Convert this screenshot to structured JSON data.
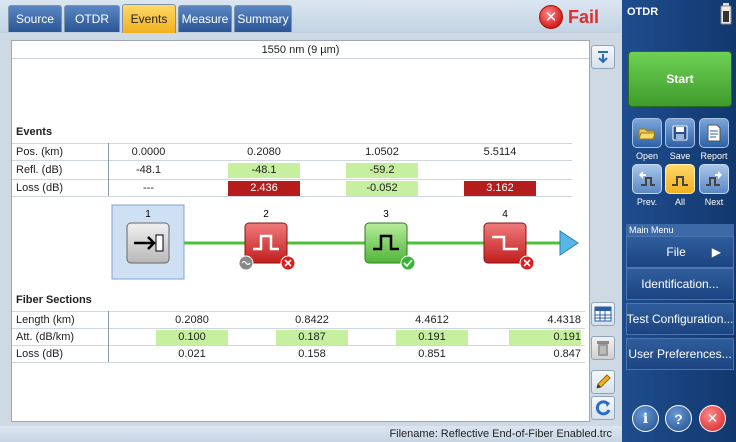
{
  "tabs": [
    {
      "label": "Source"
    },
    {
      "label": "OTDR"
    },
    {
      "label": "Events"
    },
    {
      "label": "Measure"
    },
    {
      "label": "Summary"
    }
  ],
  "active_tab": "Events",
  "status": {
    "text": "Fail",
    "color": "#e12d2d"
  },
  "wavelength": "1550 nm (9 µm)",
  "events": {
    "title": "Events",
    "rows": [
      {
        "label": "Pos. (km)",
        "values": [
          "0.0000",
          "0.2080",
          "1.0502",
          "5.5114"
        ]
      },
      {
        "label": "Refl. (dB)",
        "values": [
          "-48.1",
          "-48.1",
          "-59.2",
          ""
        ]
      },
      {
        "label": "Loss (dB)",
        "values": [
          "---",
          "2.436",
          "-0.052",
          "3.162"
        ]
      }
    ],
    "markers": [
      "1",
      "2",
      "3",
      "4"
    ]
  },
  "fiber_sections": {
    "title": "Fiber Sections",
    "rows": [
      {
        "label": "Length (km)",
        "values": [
          "0.2080",
          "0.8422",
          "4.4612",
          "4.4318"
        ]
      },
      {
        "label": "Att. (dB/km)",
        "values": [
          "0.100",
          "0.187",
          "0.191",
          "0.191"
        ]
      },
      {
        "label": "Loss (dB)",
        "values": [
          "0.021",
          "0.158",
          "0.851",
          "0.847"
        ]
      }
    ]
  },
  "filename": "Filename: Reflective End-of-Fiber Enabled.trc",
  "sidebar": {
    "title": "OTDR",
    "start_label": "Start",
    "file_buttons": [
      {
        "label": "Open"
      },
      {
        "label": "Save"
      },
      {
        "label": "Report"
      }
    ],
    "nav_buttons": [
      {
        "label": "Prev."
      },
      {
        "label": "All"
      },
      {
        "label": "Next"
      }
    ],
    "menu_title": "Main Menu",
    "menu_items": [
      {
        "label": "File"
      },
      {
        "label": "Identification..."
      },
      {
        "label": "Test Configuration..."
      },
      {
        "label": "User Preferences..."
      }
    ]
  },
  "colors": {
    "pass_green": "#c6ef9f",
    "fail_red": "#b51c1c",
    "accent_blue": "#1e4d8e",
    "start_green": "#4fb53a"
  }
}
